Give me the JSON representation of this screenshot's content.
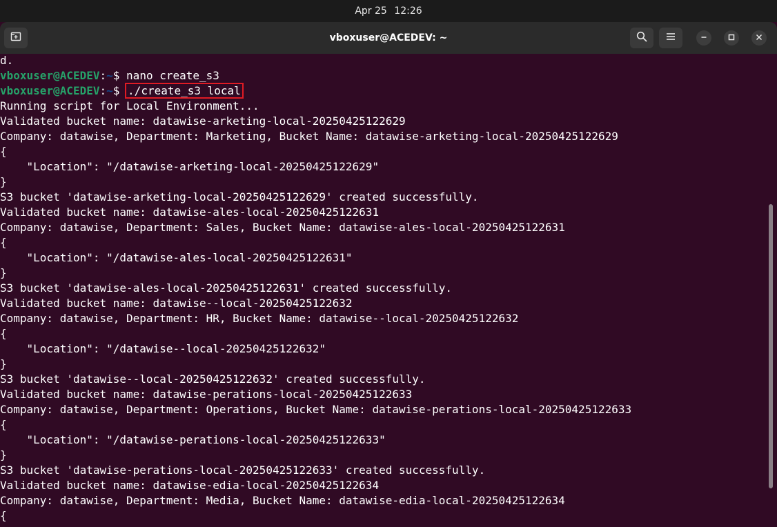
{
  "system_bar": {
    "date": "Apr 25",
    "time": "12:26"
  },
  "window": {
    "title": "vboxuser@ACEDEV: ~",
    "buttons": {
      "new_tab": "new-tab-icon",
      "search": "search-icon",
      "menu": "hamburger-menu-icon",
      "minimize": "minimize-icon",
      "maximize": "maximize-icon",
      "close": "close-icon"
    }
  },
  "colors": {
    "terminal_bg": "#300a24",
    "prompt_user": "#26a269",
    "prompt_path": "#12488b",
    "highlight_box": "#e01b24"
  },
  "terminal": {
    "first_line": "d.",
    "prompts": [
      {
        "user": "vboxuser@ACEDEV",
        "colon": ":",
        "path": "~",
        "dollar": "$ ",
        "command": "nano create_s3"
      },
      {
        "user": "vboxuser@ACEDEV",
        "colon": ":",
        "path": "~",
        "dollar": "$ ",
        "command": "./create_s3 local"
      }
    ],
    "output": [
      "Running script for Local Environment...",
      "Validated bucket name: datawise-arketing-local-20250425122629",
      "Company: datawise, Department: Marketing, Bucket Name: datawise-arketing-local-20250425122629",
      "{",
      "    \"Location\": \"/datawise-arketing-local-20250425122629\"",
      "}",
      "S3 bucket 'datawise-arketing-local-20250425122629' created successfully.",
      "Validated bucket name: datawise-ales-local-20250425122631",
      "Company: datawise, Department: Sales, Bucket Name: datawise-ales-local-20250425122631",
      "{",
      "    \"Location\": \"/datawise-ales-local-20250425122631\"",
      "}",
      "S3 bucket 'datawise-ales-local-20250425122631' created successfully.",
      "Validated bucket name: datawise--local-20250425122632",
      "Company: datawise, Department: HR, Bucket Name: datawise--local-20250425122632",
      "{",
      "    \"Location\": \"/datawise--local-20250425122632\"",
      "}",
      "S3 bucket 'datawise--local-20250425122632' created successfully.",
      "Validated bucket name: datawise-perations-local-20250425122633",
      "Company: datawise, Department: Operations, Bucket Name: datawise-perations-local-20250425122633",
      "{",
      "    \"Location\": \"/datawise-perations-local-20250425122633\"",
      "}",
      "S3 bucket 'datawise-perations-local-20250425122633' created successfully.",
      "Validated bucket name: datawise-edia-local-20250425122634",
      "Company: datawise, Department: Media, Bucket Name: datawise-edia-local-20250425122634",
      "{"
    ]
  }
}
